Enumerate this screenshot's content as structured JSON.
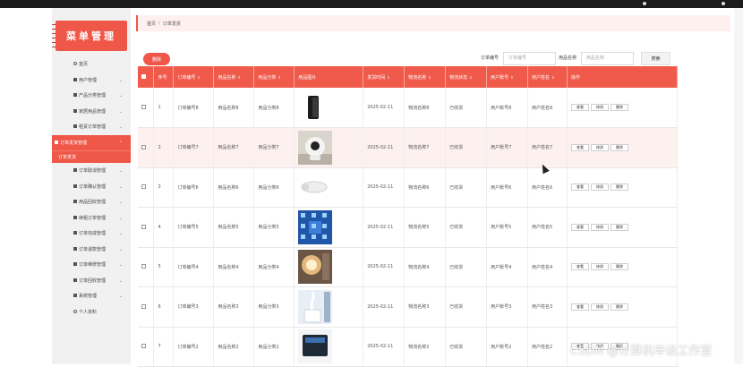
{
  "brand": {
    "title": "菜单管理"
  },
  "sidebar": {
    "items": [
      {
        "label": "首页",
        "icon": "home-icon",
        "active": false
      },
      {
        "label": "用户管理",
        "icon": "grid-icon",
        "active": false
      },
      {
        "label": "产品分类管理",
        "icon": "grid-icon",
        "active": false
      },
      {
        "label": "家居用品管理",
        "icon": "grid-icon",
        "active": false
      },
      {
        "label": "租赁订单管理",
        "icon": "grid-icon",
        "active": false
      },
      {
        "label": "订单发货管理",
        "icon": "grid-icon",
        "active": true
      },
      {
        "label": "订单发货",
        "icon": "",
        "active": true,
        "sub": true
      },
      {
        "label": "订单取消管理",
        "icon": "grid-icon",
        "active": false
      },
      {
        "label": "订单确认管理",
        "icon": "user-icon",
        "active": false
      },
      {
        "label": "用品回收管理",
        "icon": "grid-icon",
        "active": false
      },
      {
        "label": "续租订单管理",
        "icon": "grid-icon",
        "active": false
      },
      {
        "label": "订单完成管理",
        "icon": "chat-icon",
        "active": false
      },
      {
        "label": "订单退款管理",
        "icon": "cloud-icon",
        "active": false
      },
      {
        "label": "订单维修管理",
        "icon": "pin-icon",
        "active": false
      },
      {
        "label": "订单回收管理",
        "icon": "grid-icon",
        "active": false
      },
      {
        "label": "系统管理",
        "icon": "user-icon",
        "active": false
      },
      {
        "label": "个人资料",
        "icon": "circle-icon",
        "active": false
      }
    ]
  },
  "breadcrumb": {
    "home": "首页",
    "separator": "/",
    "current": "订单发货"
  },
  "toolbar": {
    "delete_label": "删除",
    "order_no_label": "订单编号",
    "order_no_placeholder": "订单编号",
    "item_name_label": "用品名称",
    "item_name_placeholder": "用品名称",
    "search_label": "搜索"
  },
  "table": {
    "headers": [
      "序号",
      "订单编号",
      "用品名称",
      "用品分类",
      "用品图片",
      "发货时间",
      "物流名称",
      "物流状态",
      "用户账号",
      "用户姓名",
      "操作"
    ],
    "sortable": [
      false,
      true,
      true,
      true,
      false,
      true,
      true,
      true,
      true,
      true,
      false
    ],
    "actions": [
      "查看",
      "修改",
      "删除"
    ],
    "rows": [
      {
        "index": "1",
        "order_no": "订单编号8",
        "item_name": "用品名称8",
        "category": "用品分类8",
        "image": "speaker",
        "ship_time": "2025-02-11",
        "logistics": "物流名称8",
        "status": "已收货",
        "account": "用户账号8",
        "user_name": "用户姓名8"
      },
      {
        "index": "2",
        "order_no": "订单编号7",
        "item_name": "用品名称7",
        "category": "用品分类7",
        "image": "camera",
        "ship_time": "2025-02-11",
        "logistics": "物流名称7",
        "status": "已收货",
        "account": "用户账号7",
        "user_name": "用户姓名7"
      },
      {
        "index": "3",
        "order_no": "订单编号6",
        "item_name": "用品名称6",
        "category": "用品分类6",
        "image": "toilet-seat",
        "ship_time": "2025-02-11",
        "logistics": "物流名称6",
        "status": "已收货",
        "account": "用户账号6",
        "user_name": "用户姓名6"
      },
      {
        "index": "4",
        "order_no": "订单编号5",
        "item_name": "用品名称5",
        "category": "用品分类5",
        "image": "smart-home",
        "ship_time": "2025-02-11",
        "logistics": "物流名称5",
        "status": "已收货",
        "account": "用户账号5",
        "user_name": "用户姓名5"
      },
      {
        "index": "5",
        "order_no": "订单编号4",
        "item_name": "用品名称4",
        "category": "用品分类4",
        "image": "lamp",
        "ship_time": "2025-02-11",
        "logistics": "物流名称4",
        "status": "已收货",
        "account": "用户账号4",
        "user_name": "用户姓名4"
      },
      {
        "index": "6",
        "order_no": "订单编号3",
        "item_name": "用品名称3",
        "category": "用品分类3",
        "image": "humidifier",
        "ship_time": "2025-02-11",
        "logistics": "物流名称3",
        "status": "已收货",
        "account": "用户账号3",
        "user_name": "用户姓名3"
      },
      {
        "index": "7",
        "order_no": "订单编号2",
        "item_name": "用品名称2",
        "category": "用品分类2",
        "image": "panel",
        "ship_time": "2025-02-11",
        "logistics": "物流名称2",
        "status": "已收货",
        "account": "用户账号2",
        "user_name": "用户姓名2"
      }
    ]
  },
  "watermark": "CSDN @计算机毕设工作室",
  "colors": {
    "accent": "#ef5748",
    "header": "#f05a4b",
    "sidebar_bg": "#f1f1f1"
  }
}
